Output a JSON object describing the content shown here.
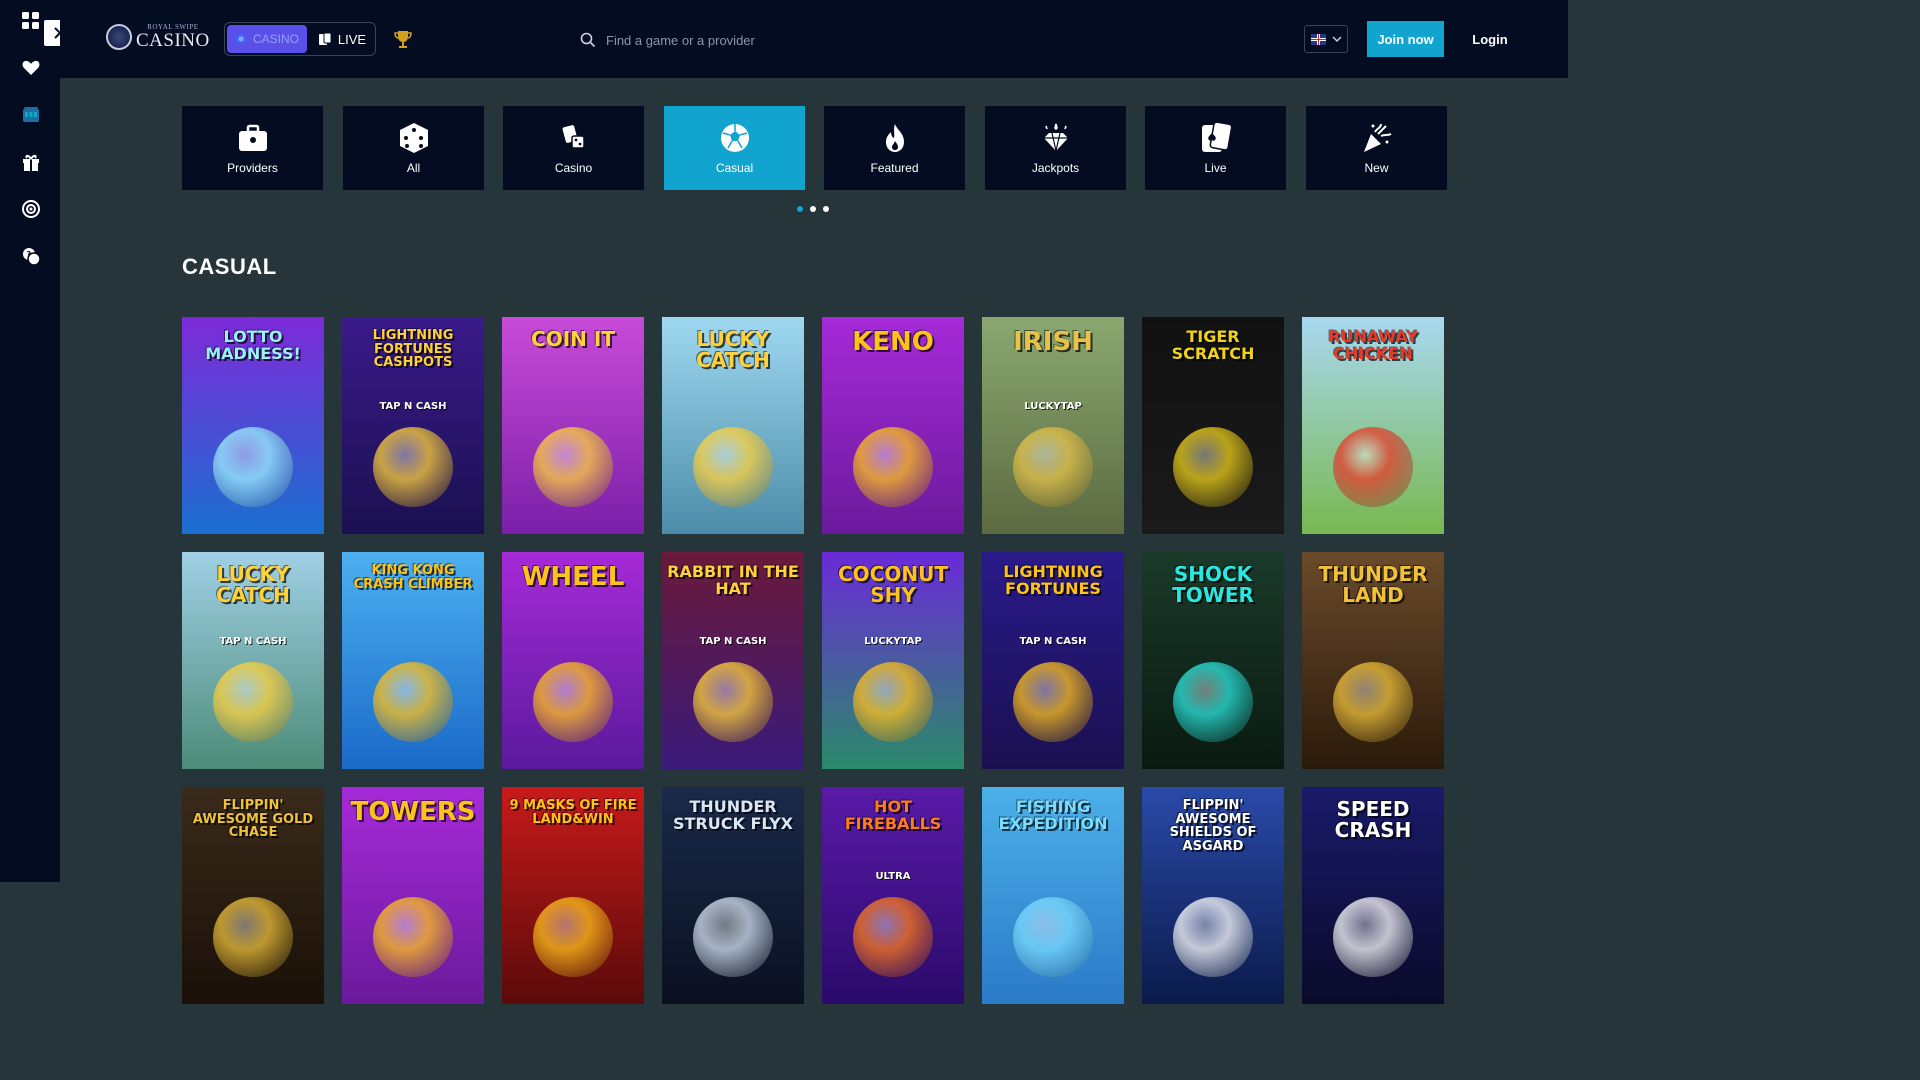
{
  "rail": {
    "items": [
      "grid-icon",
      "heart-icon",
      "jackpot-icon",
      "gift-icon",
      "target-icon",
      "chat-icon"
    ]
  },
  "header": {
    "logo_small": "ROYAL SWIPE",
    "logo_big": "CASINO",
    "mode_casino": "CASINO",
    "mode_live": "LIVE",
    "search_placeholder": "Find a game or a provider",
    "join_label": "Join now",
    "login_label": "Login",
    "language": "UK flag"
  },
  "categories": [
    {
      "label": "Providers",
      "icon": "briefcase-icon"
    },
    {
      "label": "All",
      "icon": "dice-icon"
    },
    {
      "label": "Casino",
      "icon": "cards-dice-icon"
    },
    {
      "label": "Casual",
      "icon": "soccer-ball-icon",
      "active": true
    },
    {
      "label": "Featured",
      "icon": "flame-icon"
    },
    {
      "label": "Jackpots",
      "icon": "diamond-icon"
    },
    {
      "label": "Live",
      "icon": "playing-cards-icon"
    },
    {
      "label": "New",
      "icon": "party-popper-icon"
    }
  ],
  "carousel": {
    "pages": 3,
    "active": 0
  },
  "section_title": "CASUAL",
  "games": [
    {
      "title": "LOTTO MADNESS!",
      "sub": "",
      "bg1": "#7d2ad8",
      "bg2": "#1a6fd0",
      "color": "#9ef0ff"
    },
    {
      "title": "LIGHTNING FORTUNES CASHPOTS",
      "sub": "TAP N CASH",
      "bg1": "#3a1a8a",
      "bg2": "#1a1050",
      "color": "#ffd23a"
    },
    {
      "title": "COIN IT",
      "sub": "",
      "bg1": "#c84bd8",
      "bg2": "#7a1fa8",
      "color": "#ffd23a"
    },
    {
      "title": "LUCKY CATCH",
      "sub": "",
      "bg1": "#9fd8f0",
      "bg2": "#4c8ca8",
      "color": "#ffd23a"
    },
    {
      "title": "KENO",
      "sub": "",
      "bg1": "#a62ad8",
      "bg2": "#6a1a9c",
      "color": "#ffc21a"
    },
    {
      "title": "IRISH",
      "sub": "LUCKYTAP",
      "bg1": "#8aa870",
      "bg2": "#5c6a40",
      "color": "#e6c248"
    },
    {
      "title": "TIGER SCRATCH",
      "sub": "",
      "bg1": "#111111",
      "bg2": "#1a1a1a",
      "color": "#f0d21a"
    },
    {
      "title": "RUNAWAY CHICKEN",
      "sub": "",
      "bg1": "#a8d8f0",
      "bg2": "#78b850",
      "color": "#e83a2a"
    },
    {
      "title": "LUCKY CATCH",
      "sub": "TAP N CASH",
      "bg1": "#a0d0e6",
      "bg2": "#4c8c78",
      "color": "#ffd23a"
    },
    {
      "title": "KING KONG CRASH CLIMBER",
      "sub": "",
      "bg1": "#4cb0f0",
      "bg2": "#1a6ac8",
      "color": "#ffc21a"
    },
    {
      "title": "WHEEL",
      "sub": "",
      "bg1": "#a62ad8",
      "bg2": "#5a1a9c",
      "color": "#ffc21a"
    },
    {
      "title": "RABBIT IN THE HAT",
      "sub": "TAP N CASH",
      "bg1": "#6a1a3a",
      "bg2": "#3a1a7a",
      "color": "#ffd23a"
    },
    {
      "title": "COCONUT SHY",
      "sub": "LUCKYTAP",
      "bg1": "#6a2ad8",
      "bg2": "#2a8a6a",
      "color": "#ffc21a"
    },
    {
      "title": "LIGHTNING FORTUNES",
      "sub": "TAP N CASH",
      "bg1": "#2a1a8a",
      "bg2": "#1a1050",
      "color": "#ffc21a"
    },
    {
      "title": "SHOCK TOWER",
      "sub": "",
      "bg1": "#1a3a2a",
      "bg2": "#0a1a10",
      "color": "#2ae8e0"
    },
    {
      "title": "THUNDER LAND",
      "sub": "",
      "bg1": "#6a4a2a",
      "bg2": "#2a1a0a",
      "color": "#f0c23a"
    },
    {
      "title": "FLIPPIN' AWESOME GOLD CHASE",
      "sub": "",
      "bg1": "#3a2a1a",
      "bg2": "#1a1008",
      "color": "#f0c23a"
    },
    {
      "title": "TOWERS",
      "sub": "",
      "bg1": "#a62ad8",
      "bg2": "#6a1a9c",
      "color": "#ffc21a"
    },
    {
      "title": "9 MASKS OF FIRE LAND&WIN",
      "sub": "",
      "bg1": "#c81a1a",
      "bg2": "#5a0a0a",
      "color": "#ffc21a"
    },
    {
      "title": "THUNDER STRUCK FLYX",
      "sub": "",
      "bg1": "#1a2a4a",
      "bg2": "#0a1020",
      "color": "#d8e6f6"
    },
    {
      "title": "HOT FIREBALLS",
      "sub": "ULTRA",
      "bg1": "#5a1aa8",
      "bg2": "#2a0a6a",
      "color": "#ff7a1a"
    },
    {
      "title": "FISHING EXPEDITION",
      "sub": "",
      "bg1": "#4cb0e8",
      "bg2": "#2a7ac8",
      "color": "#7adcff"
    },
    {
      "title": "FLIPPIN' AWESOME SHIELDS OF ASGARD",
      "sub": "",
      "bg1": "#2a4aa8",
      "bg2": "#0a1a4a",
      "color": "#ffffff"
    },
    {
      "title": "SPEED CRASH",
      "sub": "",
      "bg1": "#1a1a6a",
      "bg2": "#0a0a2a",
      "color": "#ffffff"
    }
  ]
}
